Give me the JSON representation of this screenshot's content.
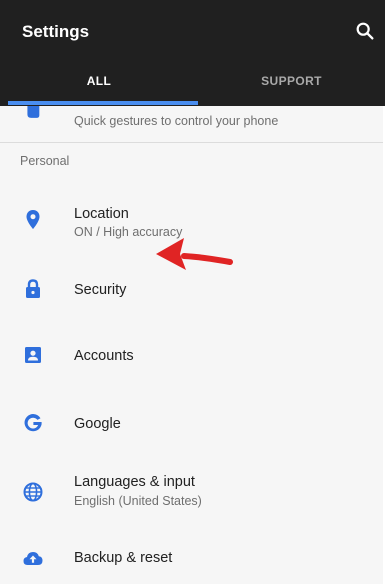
{
  "header": {
    "title": "Settings",
    "search_icon": "search-icon",
    "tabs": [
      {
        "label": "ALL",
        "selected": true
      },
      {
        "label": "SUPPORT",
        "selected": false
      }
    ]
  },
  "partial_item": {
    "subtitle": "Quick gestures to control your phone",
    "icon": "gesture-hand-icon"
  },
  "section_header": "Personal",
  "items": [
    {
      "label": "Location",
      "subtitle": "ON / High accuracy",
      "icon": "location-pin-icon"
    },
    {
      "label": "Security",
      "subtitle": "",
      "icon": "lock-icon"
    },
    {
      "label": "Accounts",
      "subtitle": "",
      "icon": "account-box-icon"
    },
    {
      "label": "Google",
      "subtitle": "",
      "icon": "google-g-icon"
    },
    {
      "label": "Languages & input",
      "subtitle": "English (United States)",
      "icon": "globe-icon"
    },
    {
      "label": "Backup & reset",
      "subtitle": "",
      "icon": "cloud-upload-icon"
    }
  ],
  "colors": {
    "app_bar": "#202020",
    "accent": "#4a8ef0",
    "icon_blue": "#2f6fdc",
    "annotation_arrow": "#e02424"
  }
}
